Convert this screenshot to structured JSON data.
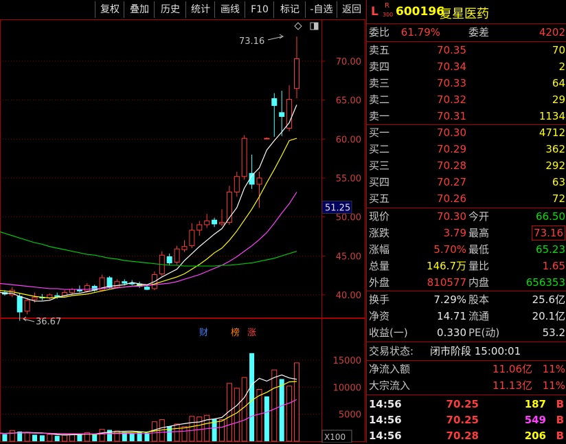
{
  "toolbar": {
    "buttons": [
      "复权",
      "叠加",
      "历史",
      "统计",
      "画线",
      "F10",
      "标记",
      "-自选",
      "返回"
    ]
  },
  "header": {
    "market_letter": "L",
    "r_mark": "R",
    "r_sub": "300",
    "code": "600196",
    "name": "复星医药"
  },
  "order_ratio": {
    "label1": "委比",
    "value1": "61.79%",
    "label2": "委差",
    "value2": "4202"
  },
  "asks": [
    {
      "label": "卖五",
      "price": "70.35",
      "vol": "70"
    },
    {
      "label": "卖四",
      "price": "70.34",
      "vol": "2"
    },
    {
      "label": "卖三",
      "price": "70.33",
      "vol": "64"
    },
    {
      "label": "卖二",
      "price": "70.32",
      "vol": "29"
    },
    {
      "label": "卖一",
      "price": "70.31",
      "vol": "1134"
    }
  ],
  "bids": [
    {
      "label": "买一",
      "price": "70.30",
      "vol": "4712"
    },
    {
      "label": "买二",
      "price": "70.29",
      "vol": "362"
    },
    {
      "label": "买三",
      "price": "70.28",
      "vol": "292"
    },
    {
      "label": "买四",
      "price": "70.27",
      "vol": "63"
    },
    {
      "label": "买五",
      "price": "70.26",
      "vol": "72"
    }
  ],
  "quote": [
    {
      "l1": "现价",
      "v1": "70.30",
      "c1": "red",
      "l2": "今开",
      "v2": "66.50",
      "c2": "green"
    },
    {
      "l1": "涨跌",
      "v1": "3.79",
      "c1": "red",
      "l2": "最高",
      "v2": "73.16",
      "c2": "red"
    },
    {
      "l1": "涨幅",
      "v1": "5.70%",
      "c1": "red",
      "l2": "最低",
      "v2": "65.23",
      "c2": "green"
    },
    {
      "l1": "总量",
      "v1": "146.7万",
      "c1": "yellow",
      "l2": "量比",
      "v2": "1.65",
      "c2": "red"
    },
    {
      "l1": "外盘",
      "v1": "810577",
      "c1": "red",
      "l2": "内盘",
      "v2": "656353",
      "c2": "green"
    }
  ],
  "fundamentals": [
    {
      "l1": "换手",
      "v1": "7.29%",
      "l2": "股本",
      "v2": "25.6亿"
    },
    {
      "l1": "净资",
      "v1": "14.71",
      "l2": "流通",
      "v2": "20.1亿"
    },
    {
      "l1": "收益(一)",
      "v1": "0.330",
      "l2": "PE(动)",
      "v2": "53.2"
    }
  ],
  "trade_status": {
    "label": "交易状态:",
    "value": "闭市阶段 15:00:01"
  },
  "flows": [
    {
      "label": "净流入额",
      "value": "11.06亿",
      "pct": "11%"
    },
    {
      "label": "大宗流入",
      "value": "11.13亿",
      "pct": "11%"
    }
  ],
  "ticks": [
    {
      "time": "14:56",
      "price": "70.25",
      "vol": "187",
      "side": "B",
      "vcolor": "yellow"
    },
    {
      "time": "14:56",
      "price": "70.25",
      "vol": "549",
      "side": "B",
      "vcolor": "magenta"
    },
    {
      "time": "14:56",
      "price": "70.28",
      "vol": "206",
      "side": "B",
      "vcolor": "yellow"
    }
  ],
  "chart_data": {
    "type": "candlestick",
    "price_axis_ticks": [
      "70.00",
      "65.00",
      "60.00",
      "55.00",
      "50.00",
      "45.00",
      "40.00"
    ],
    "current_price_label": "51.25",
    "high_annotation": "73.16",
    "low_annotation": "36.67",
    "event_markers": [
      "财",
      "榜",
      "涨"
    ],
    "volume_axis_ticks": [
      "15000",
      "10000",
      "5000"
    ],
    "volume_unit": "X100",
    "candles": [
      {
        "o": 40.4,
        "h": 40.8,
        "l": 40.0,
        "c": 40.3
      },
      {
        "o": 40.3,
        "h": 40.6,
        "l": 39.9,
        "c": 40.1
      },
      {
        "o": 40.0,
        "h": 41.0,
        "l": 39.7,
        "c": 40.6
      },
      {
        "o": 39.8,
        "h": 40.2,
        "l": 36.67,
        "c": 37.8
      },
      {
        "o": 37.9,
        "h": 39.6,
        "l": 37.5,
        "c": 39.3
      },
      {
        "o": 39.4,
        "h": 40.3,
        "l": 39.0,
        "c": 39.7
      },
      {
        "o": 39.7,
        "h": 40.1,
        "l": 39.3,
        "c": 39.6
      },
      {
        "o": 39.6,
        "h": 40.2,
        "l": 39.4,
        "c": 40.0
      },
      {
        "o": 39.9,
        "h": 40.3,
        "l": 39.5,
        "c": 39.8
      },
      {
        "o": 39.9,
        "h": 40.6,
        "l": 39.7,
        "c": 40.3
      },
      {
        "o": 40.3,
        "h": 40.9,
        "l": 40.0,
        "c": 40.7
      },
      {
        "o": 40.7,
        "h": 41.2,
        "l": 40.3,
        "c": 40.5
      },
      {
        "o": 40.5,
        "h": 41.5,
        "l": 40.3,
        "c": 41.2
      },
      {
        "o": 41.1,
        "h": 41.3,
        "l": 40.4,
        "c": 40.6
      },
      {
        "o": 40.6,
        "h": 42.6,
        "l": 40.5,
        "c": 42.2
      },
      {
        "o": 42.2,
        "h": 42.4,
        "l": 40.8,
        "c": 41.0
      },
      {
        "o": 41.0,
        "h": 42.0,
        "l": 40.8,
        "c": 41.7
      },
      {
        "o": 41.7,
        "h": 42.0,
        "l": 41.2,
        "c": 41.5
      },
      {
        "o": 41.5,
        "h": 41.9,
        "l": 41.2,
        "c": 41.4
      },
      {
        "o": 41.4,
        "h": 41.7,
        "l": 40.9,
        "c": 41.1
      },
      {
        "o": 41.0,
        "h": 41.3,
        "l": 40.6,
        "c": 40.7
      },
      {
        "o": 40.8,
        "h": 43.0,
        "l": 40.6,
        "c": 42.6
      },
      {
        "o": 42.7,
        "h": 45.6,
        "l": 42.4,
        "c": 45.1
      },
      {
        "o": 44.9,
        "h": 45.3,
        "l": 43.8,
        "c": 44.1
      },
      {
        "o": 44.2,
        "h": 46.3,
        "l": 43.9,
        "c": 45.9
      },
      {
        "o": 45.8,
        "h": 47.0,
        "l": 45.5,
        "c": 46.2
      },
      {
        "o": 46.3,
        "h": 49.2,
        "l": 46.0,
        "c": 48.3
      },
      {
        "o": 48.3,
        "h": 49.5,
        "l": 47.6,
        "c": 49.0
      },
      {
        "o": 49.0,
        "h": 50.4,
        "l": 48.6,
        "c": 49.5
      },
      {
        "o": 49.6,
        "h": 49.9,
        "l": 48.7,
        "c": 49.1
      },
      {
        "o": 49.1,
        "h": 51.0,
        "l": 48.8,
        "c": 49.3
      },
      {
        "o": 49.3,
        "h": 54.0,
        "l": 49.0,
        "c": 53.2
      },
      {
        "o": 53.2,
        "h": 55.8,
        "l": 52.6,
        "c": 55.2
      },
      {
        "o": 55.2,
        "h": 60.5,
        "l": 54.8,
        "c": 60.1
      },
      {
        "o": 55.6,
        "h": 58.0,
        "l": 53.6,
        "c": 54.2
      },
      {
        "o": 54.2,
        "h": 55.8,
        "l": 51.2,
        "c": 55.0
      },
      {
        "o": 60.1,
        "h": 60.2,
        "l": 60.0,
        "c": 60.1
      },
      {
        "o": 65.2,
        "h": 65.9,
        "l": 60.3,
        "c": 64.3
      },
      {
        "o": 63.4,
        "h": 66.2,
        "l": 60.4,
        "c": 62.9
      },
      {
        "o": 61.4,
        "h": 66.9,
        "l": 61.0,
        "c": 65.1
      },
      {
        "o": 66.5,
        "h": 73.16,
        "l": 65.23,
        "c": 70.3
      }
    ],
    "volumes": [
      1500,
      1300,
      2000,
      1800,
      1600,
      1200,
      1100,
      1300,
      1000,
      1200,
      1400,
      1200,
      1600,
      1300,
      2200,
      2100,
      1900,
      1700,
      1500,
      1700,
      1600,
      3600,
      4000,
      2800,
      3200,
      2700,
      4600,
      4500,
      4800,
      4100,
      4000,
      10700,
      9800,
      11800,
      16300,
      9600,
      8300,
      13200,
      11500,
      10200,
      14500
    ],
    "volume_colors": [
      "c",
      "c",
      "r",
      "c",
      "r",
      "c",
      "c",
      "r",
      "c",
      "r",
      "r",
      "c",
      "r",
      "c",
      "r",
      "c",
      "r",
      "c",
      "c",
      "c",
      "c",
      "r",
      "r",
      "c",
      "r",
      "r",
      "r",
      "r",
      "r",
      "c",
      "r",
      "r",
      "r",
      "r",
      "c",
      "r",
      "c",
      "r",
      "c",
      "r",
      "r"
    ],
    "ma5": [
      40.4,
      40.2,
      40.2,
      39.8,
      39.5,
      39.2,
      39.2,
      39.3,
      39.7,
      39.9,
      40.1,
      40.2,
      40.4,
      40.6,
      40.9,
      41.1,
      41.2,
      41.3,
      41.6,
      41.4,
      41.3,
      41.7,
      42.3,
      42.8,
      43.3,
      44.4,
      45.3,
      46.2,
      47.0,
      47.8,
      48.5,
      49.9,
      51.2,
      53.7,
      55.3,
      56.3,
      58.6,
      59.8,
      60.9,
      62.1,
      64.4
    ],
    "ma10": [
      40.6,
      40.5,
      40.4,
      40.2,
      40.0,
      39.8,
      39.7,
      39.6,
      39.7,
      39.7,
      39.9,
      40.0,
      40.1,
      40.3,
      40.5,
      40.7,
      40.9,
      41.0,
      41.1,
      41.2,
      41.2,
      41.4,
      41.7,
      42.0,
      42.3,
      42.7,
      43.3,
      43.9,
      44.6,
      45.4,
      46.0,
      47.0,
      48.2,
      49.6,
      51.0,
      52.6,
      54.4,
      56.1,
      57.9,
      59.8,
      60.1
    ],
    "ma20": [
      41.5,
      41.4,
      41.3,
      41.2,
      41.1,
      41.0,
      40.9,
      40.8,
      40.8,
      40.7,
      40.7,
      40.7,
      40.7,
      40.8,
      40.8,
      40.9,
      40.9,
      41.0,
      41.1,
      41.1,
      41.2,
      41.3,
      41.4,
      41.5,
      41.7,
      42.0,
      42.3,
      42.6,
      43.0,
      43.4,
      43.8,
      44.3,
      44.9,
      45.6,
      46.3,
      47.1,
      48.0,
      49.2,
      50.5,
      51.7,
      53.2
    ],
    "ma60": [
      48.2,
      47.9,
      47.6,
      47.3,
      47.0,
      46.7,
      46.5,
      46.2,
      46.0,
      45.8,
      45.6,
      45.4,
      45.2,
      45.1,
      44.9,
      44.7,
      44.6,
      44.4,
      44.3,
      44.2,
      44.1,
      44.0,
      43.9,
      43.8,
      43.8,
      43.7,
      43.7,
      43.7,
      43.7,
      43.7,
      43.8,
      43.8,
      43.9,
      44.0,
      44.1,
      44.3,
      44.5,
      44.7,
      45.0,
      45.3,
      45.6
    ],
    "vol_ma5": [
      1500,
      1450,
      1500,
      1600,
      1640,
      1580,
      1540,
      1400,
      1240,
      1160,
      1200,
      1220,
      1340,
      1340,
      1540,
      1680,
      1820,
      1840,
      1880,
      1780,
      1680,
      2080,
      2500,
      2760,
      3040,
      3260,
      3460,
      3560,
      3960,
      4140,
      4400,
      5580,
      6620,
      8080,
      10480,
      11640,
      11120,
      11800,
      12260,
      11720,
      11460
    ],
    "vol_ma10": [
      1500,
      1450,
      1500,
      1550,
      1560,
      1510,
      1480,
      1470,
      1420,
      1400,
      1370,
      1310,
      1300,
      1290,
      1350,
      1440,
      1510,
      1560,
      1640,
      1690,
      1720,
      1890,
      2090,
      2230,
      2360,
      2470,
      2720,
      2960,
      3290,
      3520,
      3740,
      4520,
      5240,
      6320,
      7560,
      8450,
      9050,
      9840,
      10310,
      10980,
      11060
    ],
    "vol_ma20": [
      1500,
      1450,
      1500,
      1550,
      1560,
      1510,
      1480,
      1470,
      1420,
      1400,
      1400,
      1380,
      1370,
      1360,
      1380,
      1400,
      1420,
      1430,
      1430,
      1440,
      1450,
      1550,
      1670,
      1720,
      1800,
      1870,
      2010,
      2160,
      2330,
      2480,
      2590,
      3050,
      3450,
      3920,
      4650,
      5030,
      5360,
      5950,
      6580,
      7050,
      7720
    ]
  }
}
